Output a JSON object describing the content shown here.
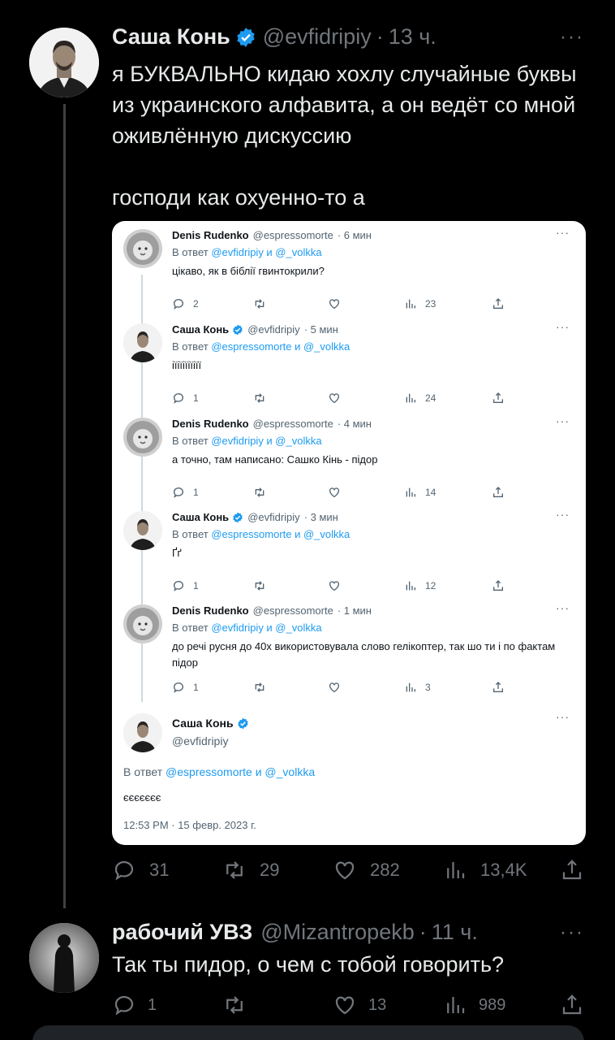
{
  "main_tweet": {
    "name": "Саша Конь",
    "handle": "@evfidripiy",
    "dot": "·",
    "time": "13 ч.",
    "more": "···",
    "text_lines": [
      "я БУКВАЛЬНО кидаю хохлу случайные буквы из украинского алфавита, а он ведёт со мной оживлённую дискуссию",
      "господи как охуенно-то а"
    ],
    "actions": {
      "replies": "31",
      "retweets": "29",
      "likes": "282",
      "views": "13,4K"
    }
  },
  "embedded": {
    "tweets": [
      {
        "name": "Denis Rudenko",
        "verified": false,
        "handle": "@espressomorte",
        "time": "· 6 мин",
        "reply_prefix": "В ответ",
        "reply_links": "@evfidripiy и @_volkka",
        "text": "цікаво, як в біблії гвинтокрили?",
        "replies": "2",
        "views": "23"
      },
      {
        "name": "Саша Конь",
        "verified": true,
        "handle": "@evfidripiy",
        "time": "· 5 мин",
        "reply_prefix": "В ответ",
        "reply_links": "@espressomorte и @_volkka",
        "text": "іїіїіїіїіїї",
        "replies": "1",
        "views": "24"
      },
      {
        "name": "Denis Rudenko",
        "verified": false,
        "handle": "@espressomorte",
        "time": "· 4 мин",
        "reply_prefix": "В ответ",
        "reply_links": "@evfidripiy и @_volkka",
        "text": "а точно, там написано: Сашко Кінь - підор",
        "replies": "1",
        "views": "14"
      },
      {
        "name": "Саша Конь",
        "verified": true,
        "handle": "@evfidripiy",
        "time": "· 3 мин",
        "reply_prefix": "В ответ",
        "reply_links": "@espressomorte и @_volkka",
        "text": "Ґґ",
        "replies": "1",
        "views": "12"
      },
      {
        "name": "Denis Rudenko",
        "verified": false,
        "handle": "@espressomorte",
        "time": "· 1 мин",
        "reply_prefix": "В ответ",
        "reply_links": "@evfidripiy и @_volkka",
        "text": "до речі русня до 40х використовувала слово гелікоптер, так шо ти і по фактам підор",
        "replies": "1",
        "views": "3"
      }
    ],
    "last": {
      "name": "Саша Конь",
      "handle": "@evfidripiy",
      "reply_prefix": "В ответ",
      "reply_links": "@espressomorte и @_volkka",
      "text": "єєєєєєє",
      "timestamp": "12:53 PM · 15 февр. 2023 г."
    }
  },
  "reply_tweet": {
    "name": "рабочий УВЗ",
    "handle": "@Mizantropekb",
    "dot": "·",
    "time": "11 ч.",
    "more": "···",
    "text": "Так ты пидор, о чем с тобой говорить?",
    "actions": {
      "replies": "1",
      "likes": "13",
      "views": "989"
    }
  },
  "colors": {
    "background": "#000000",
    "text": "#e7e9ea",
    "muted": "#71767b",
    "accent": "#1d9bf0"
  },
  "icons": [
    "verified-badge-icon",
    "reply-icon",
    "retweet-icon",
    "like-icon",
    "views-icon",
    "share-icon",
    "more-icon"
  ]
}
